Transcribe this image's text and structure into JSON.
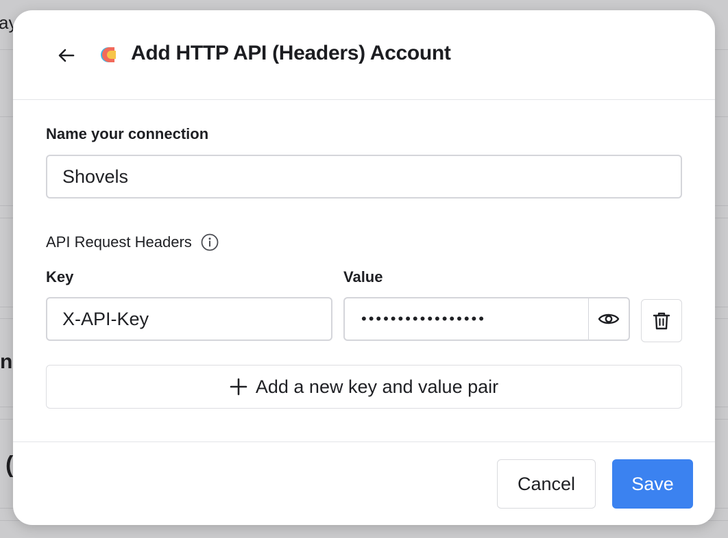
{
  "background": {
    "fragments": [
      "ay",
      "n",
      "("
    ]
  },
  "dialog": {
    "title": "Add HTTP API (Headers) Account",
    "back_icon": "arrow-left-icon",
    "logo_icon": "app-logo-icon",
    "connection": {
      "label": "Name your connection",
      "value": "Shovels",
      "placeholder": ""
    },
    "headers": {
      "label": "API Request Headers",
      "info_icon": "info-icon",
      "key_label": "Key",
      "value_label": "Value",
      "rows": [
        {
          "key": "X-API-Key",
          "value_masked": "•••••••••••••••••",
          "reveal_icon": "eye-icon",
          "delete_icon": "trash-icon"
        }
      ],
      "add_label": "Add a new key and value pair",
      "add_icon": "plus-icon"
    },
    "footer": {
      "cancel_label": "Cancel",
      "save_label": "Save"
    }
  },
  "colors": {
    "primary": "#3b82f0",
    "border": "#d4d5da",
    "text": "#1e1f23",
    "backdrop": "#cbcbcd"
  }
}
